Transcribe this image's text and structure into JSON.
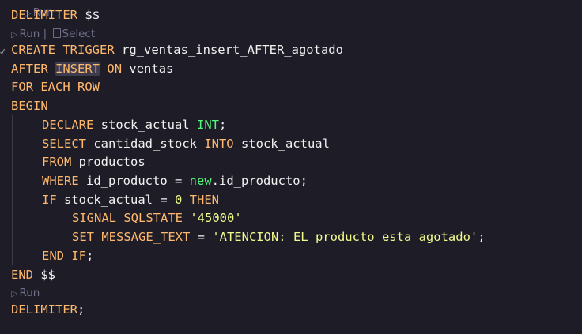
{
  "codelens": {
    "run": "Run",
    "separator": " | ",
    "select": "Select"
  },
  "code": {
    "l_delimiter_open_kw": "DELIMITER",
    "l_delimiter_open_sym": " $$",
    "l1_kw": "CREATE TRIGGER",
    "l1_id": " rg_ventas_insert_AFTER_agotado",
    "l2_kw1": "AFTER",
    "l2_kw2": "INSERT",
    "l2_kw3": "ON",
    "l2_id": " ventas",
    "l3_kw": "FOR EACH ROW",
    "l4_kw": "BEGIN",
    "l5_kw": "DECLARE",
    "l5_id": " stock_actual ",
    "l5_type": "INT",
    "l5_end": ";",
    "l6_kw": "SELECT",
    "l6_id": " cantidad_stock ",
    "l6_kw2": "INTO",
    "l6_id2": " stock_actual",
    "l7_kw": "FROM",
    "l7_id": " productos",
    "l8_kw": "WHERE",
    "l8_id": " id_producto = ",
    "l8_new": "new",
    "l8_rest": ".id_producto;",
    "l9_kw": "IF",
    "l9_id": " stock_actual = ",
    "l9_num": "0",
    "l9_kw2": "THEN",
    "l10_kw": "SIGNAL SQLSTATE",
    "l10_str": "'45000'",
    "l11_kw": "SET MESSAGE_TEXT",
    "l11_op": " = ",
    "l11_str": "'ATENCION: EL producto esta agotado'",
    "l11_end": ";",
    "l12_kw": "END",
    "l12_kw2": "IF",
    "l12_end": ";",
    "l13_kw": "END",
    "l13_sym": " $$",
    "l14_kw": "DELIMITER",
    "l14_end": ";"
  },
  "colors": {
    "background": "#1e1d27",
    "keyword": "#ffb86c",
    "keyword_green": "#50fa7b",
    "string": "#f1fa8c",
    "identifier": "#f2f2f2",
    "codelens": "#6f6f8a"
  },
  "icons": {
    "run": "play-triangle-icon",
    "select": "copy-icon"
  }
}
